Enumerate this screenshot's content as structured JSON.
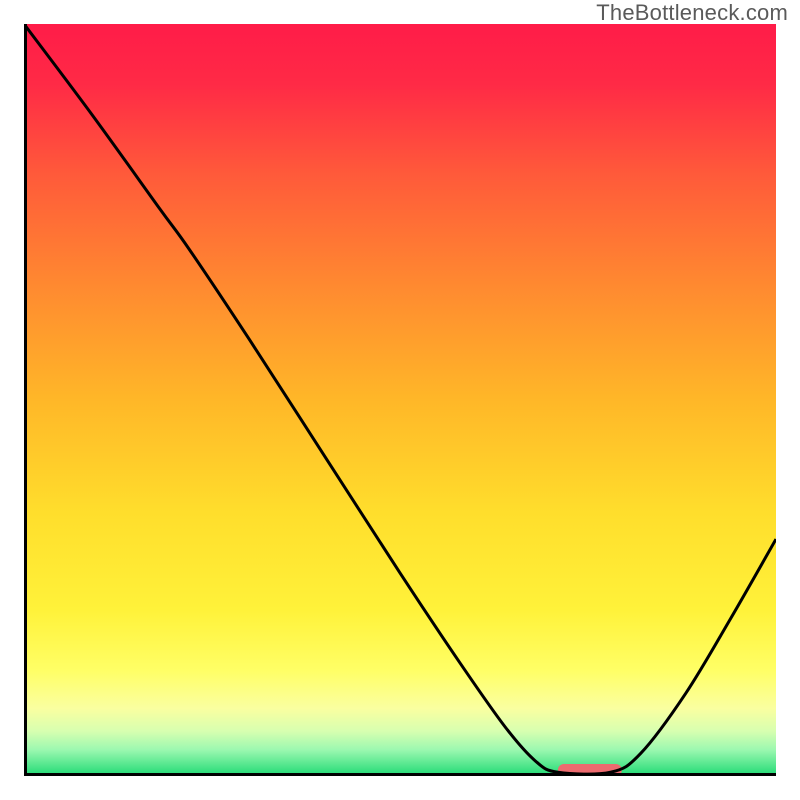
{
  "attribution": "TheBottleneck.com",
  "chart_data": {
    "type": "line",
    "title": "",
    "xlabel": "",
    "ylabel": "",
    "xlim": [
      0,
      100
    ],
    "ylim": [
      0,
      100
    ],
    "grid": false,
    "legend": false,
    "gradient_stops": [
      {
        "offset": 0.0,
        "color": "#ff1c48"
      },
      {
        "offset": 0.08,
        "color": "#ff2a46"
      },
      {
        "offset": 0.2,
        "color": "#ff5a3a"
      },
      {
        "offset": 0.35,
        "color": "#ff8a30"
      },
      {
        "offset": 0.5,
        "color": "#ffb728"
      },
      {
        "offset": 0.65,
        "color": "#ffde2c"
      },
      {
        "offset": 0.78,
        "color": "#fff23a"
      },
      {
        "offset": 0.86,
        "color": "#ffff66"
      },
      {
        "offset": 0.91,
        "color": "#faffa0"
      },
      {
        "offset": 0.94,
        "color": "#d8ffb0"
      },
      {
        "offset": 0.965,
        "color": "#9cf8b0"
      },
      {
        "offset": 0.985,
        "color": "#55e78e"
      },
      {
        "offset": 1.0,
        "color": "#1fd973"
      }
    ],
    "series": [
      {
        "name": "bottleneck-curve",
        "color": "#000000",
        "points": [
          {
            "x": 0.0,
            "y": 100.0
          },
          {
            "x": 9.0,
            "y": 88.0
          },
          {
            "x": 18.0,
            "y": 75.5
          },
          {
            "x": 22.0,
            "y": 70.0
          },
          {
            "x": 30.0,
            "y": 58.0
          },
          {
            "x": 40.0,
            "y": 42.5
          },
          {
            "x": 50.0,
            "y": 27.0
          },
          {
            "x": 58.0,
            "y": 15.0
          },
          {
            "x": 64.0,
            "y": 6.5
          },
          {
            "x": 68.0,
            "y": 2.0
          },
          {
            "x": 71.0,
            "y": 0.5
          },
          {
            "x": 78.0,
            "y": 0.5
          },
          {
            "x": 82.0,
            "y": 3.0
          },
          {
            "x": 88.0,
            "y": 11.0
          },
          {
            "x": 94.0,
            "y": 21.0
          },
          {
            "x": 100.0,
            "y": 31.5
          }
        ]
      }
    ],
    "marker": {
      "name": "optimal-range",
      "color": "#ed6b6f",
      "x_start": 71.0,
      "x_end": 79.5,
      "y": 0.8,
      "thickness_pct": 1.6
    },
    "axes": {
      "color": "#000000",
      "width": 3
    }
  }
}
